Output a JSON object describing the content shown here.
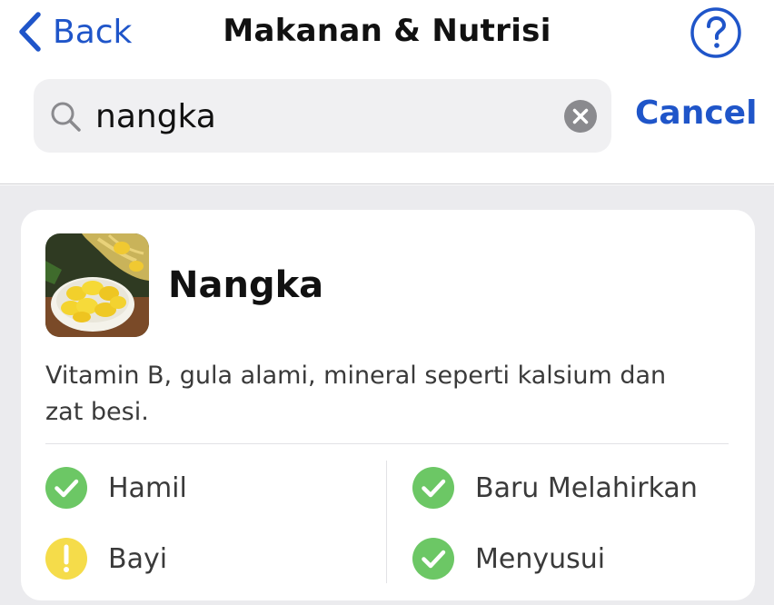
{
  "header": {
    "back_label": "Back",
    "title": "Makanan & Nutrisi",
    "help_icon": "question-circle-icon"
  },
  "search": {
    "value": "nangka",
    "cancel_label": "Cancel"
  },
  "result": {
    "name": "Nangka",
    "description": "Vitamin B, gula alami, mineral seperti kalsium dan zat besi.",
    "statuses": [
      {
        "label": "Hamil",
        "icon": "check-circle-icon",
        "color": "#6cc765"
      },
      {
        "label": "Baru Melahirkan",
        "icon": "check-circle-icon",
        "color": "#6cc765"
      },
      {
        "label": "Bayi",
        "icon": "warning-circle-icon",
        "color": "#f5dc4a"
      },
      {
        "label": "Menyusui",
        "icon": "check-circle-icon",
        "color": "#6cc765"
      }
    ]
  },
  "colors": {
    "accent": "#1f55c9",
    "safe": "#6cc765",
    "caution": "#f5dc4a"
  }
}
